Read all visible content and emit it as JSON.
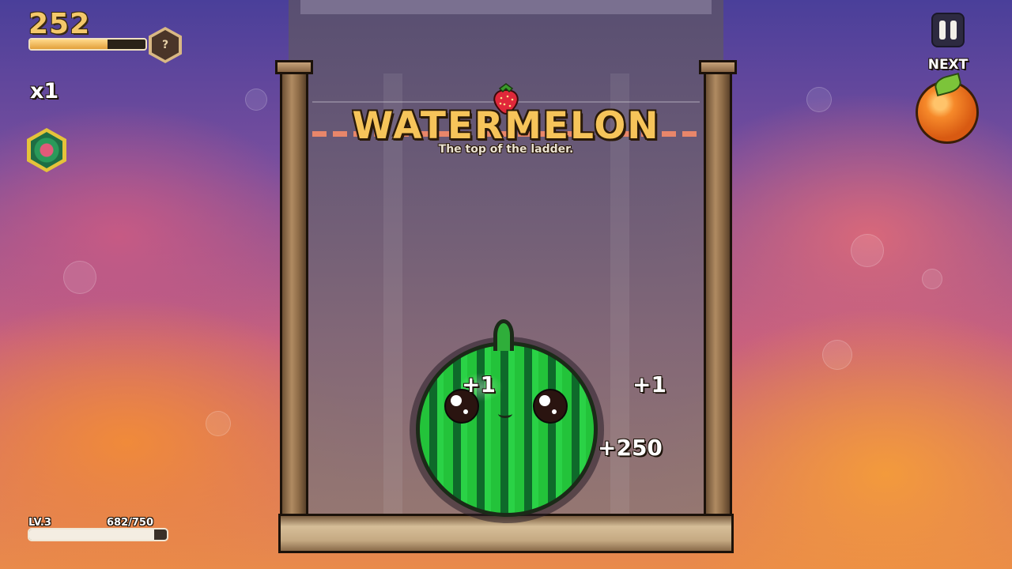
{
  "hud": {
    "score": "252",
    "score_progress": 0.67,
    "help_badge": "?",
    "multiplier": "x1",
    "level_label": "LV.3",
    "xp_label": "682/750",
    "xp_progress": 0.909
  },
  "controls": {
    "next_label": "NEXT",
    "next_fruit_icon": "orange-icon",
    "pause_icon": "pause-icon"
  },
  "announcement": {
    "title": "WATERMELON",
    "subtitle": "The top of the ladder."
  },
  "score_popups": [
    "+1",
    "+1",
    "+250"
  ],
  "colors": {
    "title": "#f6c45a",
    "score": "#f4c86a",
    "limit_line": "#e8866a",
    "watermelon_green": "#23c33a"
  }
}
